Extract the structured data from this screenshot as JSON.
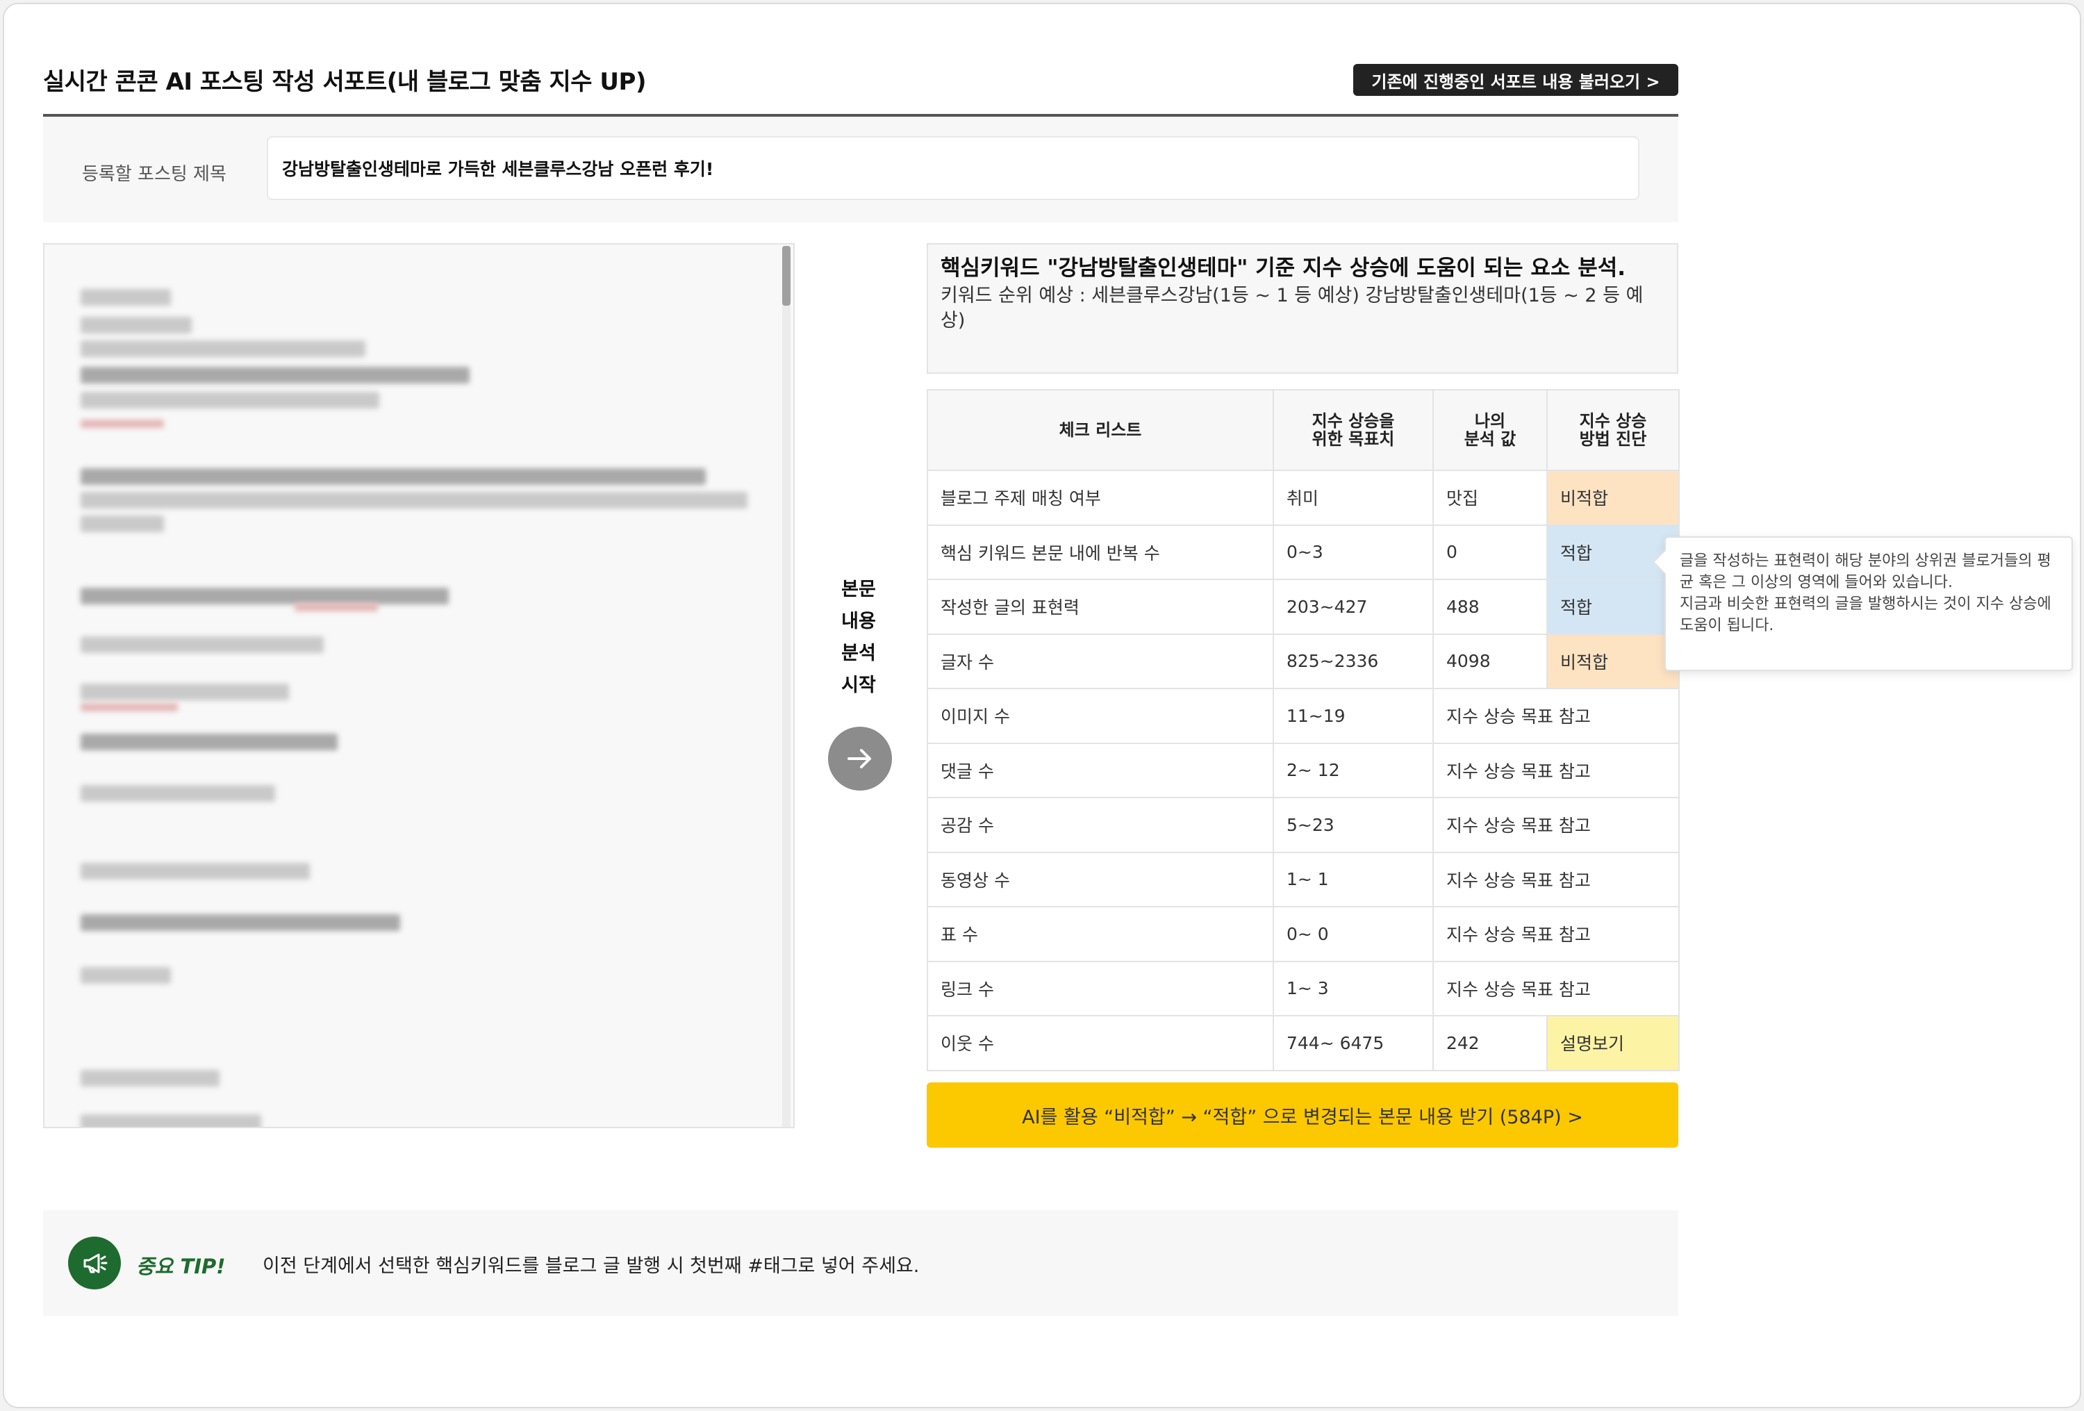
{
  "header": {
    "title": "실시간 콘콘 AI 포스팅 작성 서포트(내 블로그 맞춤 지수 UP)",
    "load_button": "기존에 진행중인 서포트 내용 불러오기 >"
  },
  "post": {
    "title_label": "등록할 포스팅 제목",
    "title_value": "강남방탈출인생테마로 가득한 세븐클루스강남 오픈런 후기!"
  },
  "analyze": {
    "label": "본문 내용 분석 시작",
    "icon": "arrow-right-icon"
  },
  "analysis": {
    "title": "핵심키워드 \"강남방탈출인생테마\" 기준 지수 상승에 도움이 되는 요소 분석.",
    "subtitle": "키워드 순위 예상 : 세븐클루스강남(1등 ~ 1 등 예상) 강남방탈출인생테마(1등 ~ 2 등 예상)"
  },
  "checklist": {
    "headers": [
      "체크 리스트",
      "지수 상승을 위한 목표치",
      "나의 분석 값",
      "지수 상승 방법 진단"
    ],
    "rows": [
      {
        "item": "블로그 주제 매칭 여부",
        "target": "취미",
        "mine": "맛집",
        "status": "비적합"
      },
      {
        "item": "핵심 키워드 본문 내에 반복 수",
        "target": "0~3",
        "mine": "0",
        "status": "적합"
      },
      {
        "item": "작성한 글의 표현력",
        "target": "203~427",
        "mine": "488",
        "status": "적합"
      },
      {
        "item": "글자 수",
        "target": "825~2336",
        "mine": "4098",
        "status": "비적합"
      },
      {
        "item": "이미지 수",
        "target": "11~19",
        "note": "지수 상승 목표 참고"
      },
      {
        "item": "댓글 수",
        "target": "2~ 12",
        "note": "지수 상승 목표 참고"
      },
      {
        "item": "공감 수",
        "target": "5~23",
        "note": "지수 상승 목표 참고"
      },
      {
        "item": "동영상 수",
        "target": "1~ 1",
        "note": "지수 상승 목표 참고"
      },
      {
        "item": "표 수",
        "target": "0~ 0",
        "note": "지수 상승 목표 참고"
      },
      {
        "item": "링크 수",
        "target": "1~ 3",
        "note": "지수 상승 목표 참고"
      },
      {
        "item": "이웃 수",
        "target": "744~ 6475",
        "mine": "242",
        "status": "설명보기"
      }
    ]
  },
  "tooltip": {
    "line1": "글을 작성하는 표현력이 해당 분야의 상위권 블로거들의 평균 혹은 그 이상의 영역에 들어와 있습니다.",
    "line2": "지금과 비슷한 표현력의 글을 발행하시는 것이 지수 상승에 도움이 됩니다."
  },
  "ai_button": "AI를 활용 “비적합” → “적합” 으로 변경되는 본문 내용 받기 (584P) >",
  "tip": {
    "label": "중요 TIP!",
    "text": "이전 단계에서 선택한 핵심키워드를 블로그 글 발행 시 첫번째 #태그로 넣어 주세요.",
    "icon": "megaphone-icon"
  },
  "colors": {
    "accent_yellow": "#fcc800",
    "bad": "#fde3c2",
    "good": "#d4e6f4",
    "info": "#fdf3a4",
    "tip_green": "#1e6b2f"
  }
}
